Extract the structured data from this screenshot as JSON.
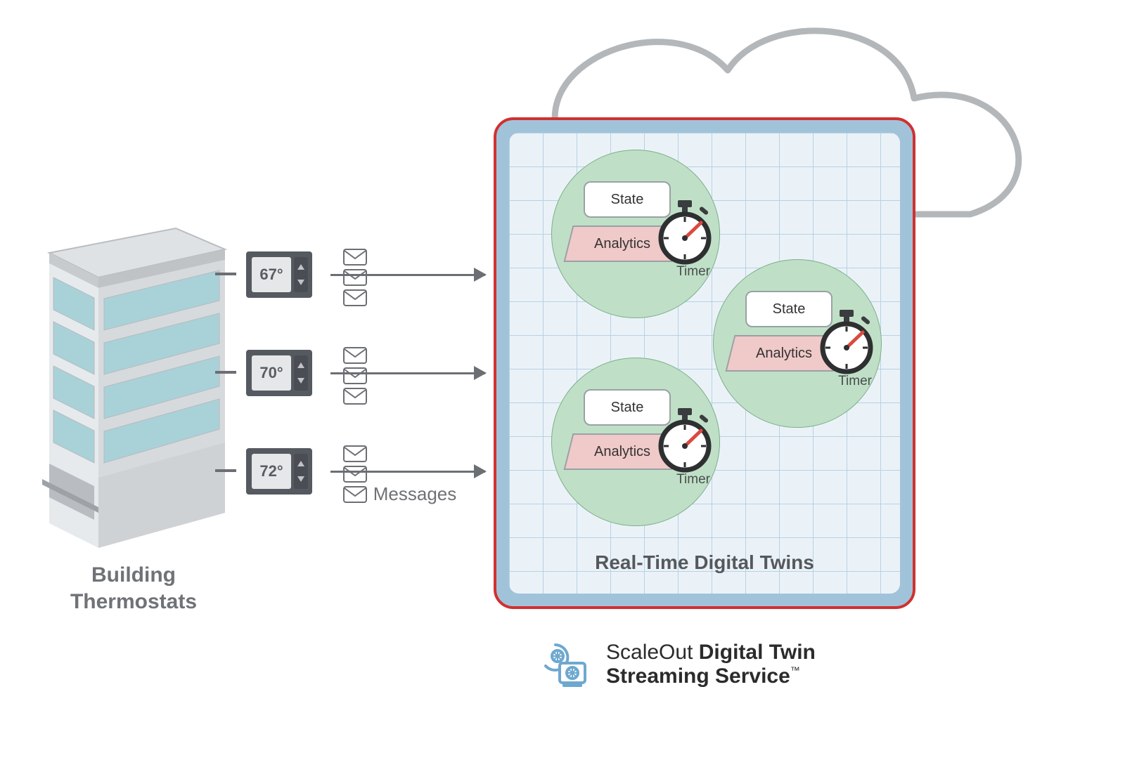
{
  "thermostats": [
    {
      "reading": "67°"
    },
    {
      "reading": "70°"
    },
    {
      "reading": "72°"
    }
  ],
  "building_label_line1": "Building",
  "building_label_line2": "Thermostats",
  "messages_label": "Messages",
  "twin": {
    "state_label": "State",
    "analytics_label": "Analytics",
    "timer_label": "Timer"
  },
  "panel_caption": "Real-Time Digital Twins",
  "footer": {
    "brand": "ScaleOut",
    "product1": "Digital Twin",
    "product2": "Streaming Service",
    "tm": "™"
  }
}
